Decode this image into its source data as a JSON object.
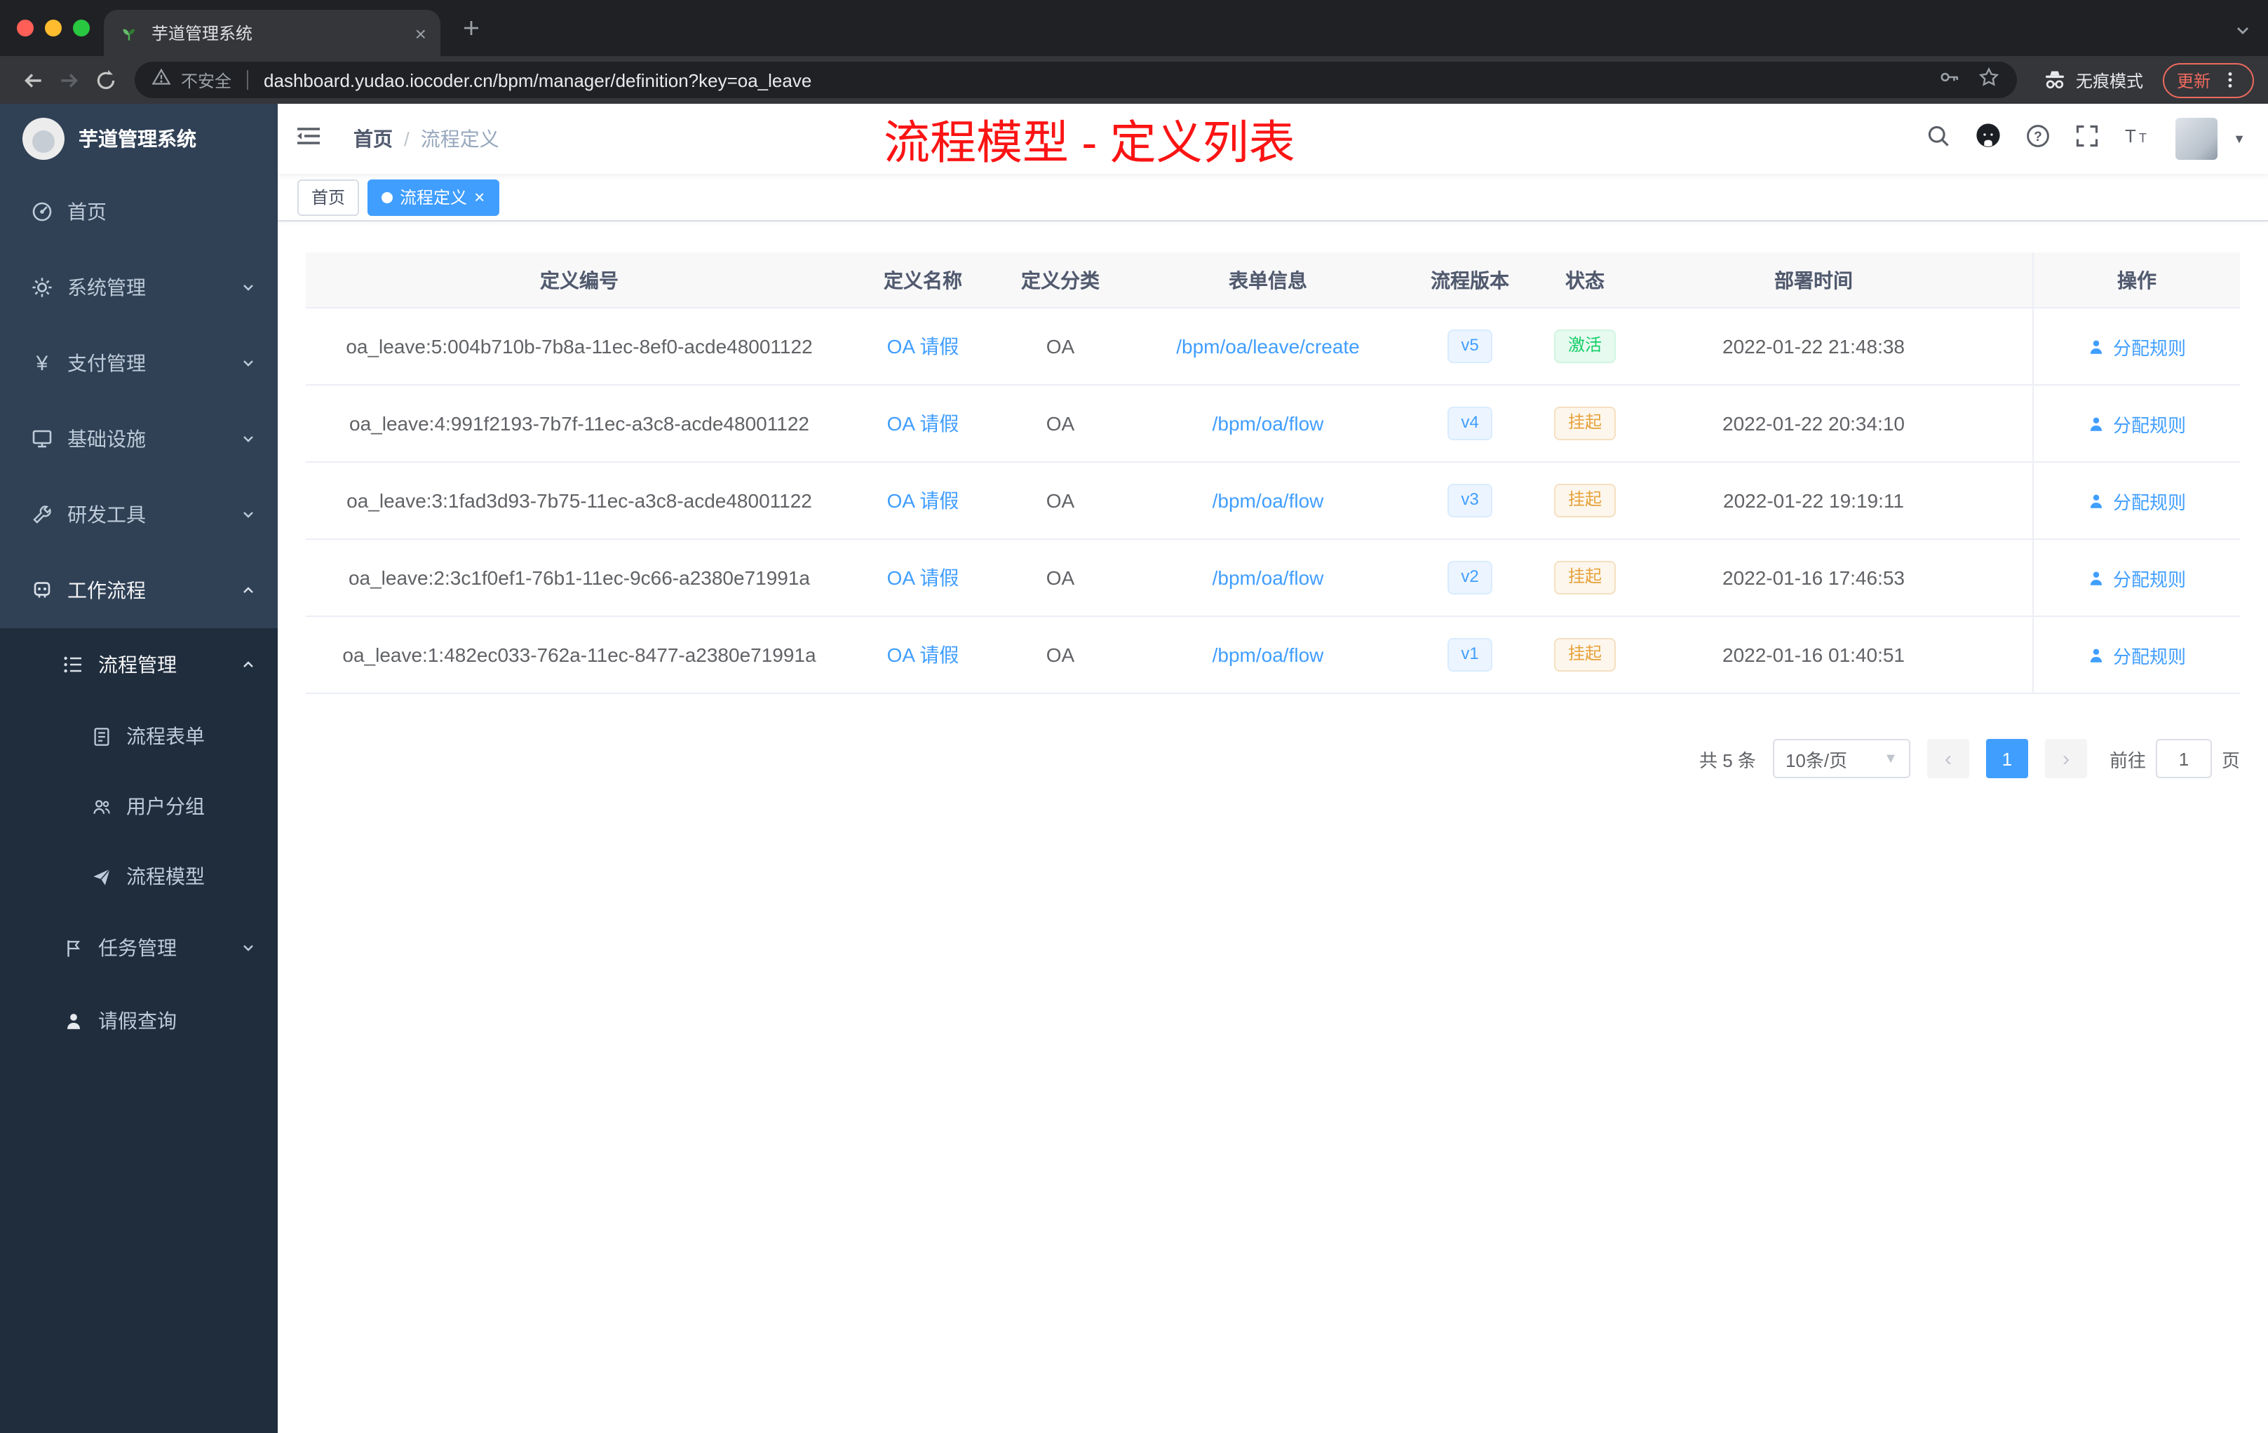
{
  "colors": {
    "accent": "#409eff",
    "success": "#13ce66",
    "warning": "#e6a23c",
    "annotation": "#fb1414",
    "sidebar_bg": "#304156",
    "submenu_bg": "#1f2d3d"
  },
  "browser": {
    "tab_title": "芋道管理系统",
    "security_label": "不安全",
    "url": "dashboard.yudao.iocoder.cn/bpm/manager/definition?key=oa_leave",
    "incognito_label": "无痕模式",
    "update_label": "更新"
  },
  "sidebar": {
    "logo_title": "芋道管理系统",
    "items": [
      {
        "label": "首页"
      },
      {
        "label": "系统管理"
      },
      {
        "label": "支付管理"
      },
      {
        "label": "基础设施"
      },
      {
        "label": "研发工具"
      },
      {
        "label": "工作流程"
      }
    ],
    "submenu": {
      "group_label": "流程管理",
      "group_children": [
        {
          "label": "流程表单"
        },
        {
          "label": "用户分组"
        },
        {
          "label": "流程模型"
        }
      ],
      "task_label": "任务管理",
      "leave_label": "请假查询"
    }
  },
  "navbar": {
    "breadcrumb_home": "首页",
    "breadcrumb_sep": "/",
    "breadcrumb_current": "流程定义",
    "annotation": "流程模型 - 定义列表"
  },
  "tags": {
    "home": "首页",
    "active": "流程定义",
    "close": "×"
  },
  "table": {
    "columns": [
      "定义编号",
      "定义名称",
      "定义分类",
      "表单信息",
      "流程版本",
      "状态",
      "部署时间",
      "操作"
    ],
    "rows": [
      {
        "id": "oa_leave:5:004b710b-7b8a-11ec-8ef0-acde48001122",
        "name": "OA 请假",
        "category": "OA",
        "form": "/bpm/oa/leave/create",
        "version": "v5",
        "status": "激活",
        "status_type": "success",
        "time": "2022-01-22 21:48:38",
        "action": "分配规则"
      },
      {
        "id": "oa_leave:4:991f2193-7b7f-11ec-a3c8-acde48001122",
        "name": "OA 请假",
        "category": "OA",
        "form": "/bpm/oa/flow",
        "version": "v4",
        "status": "挂起",
        "status_type": "warning",
        "time": "2022-01-22 20:34:10",
        "action": "分配规则"
      },
      {
        "id": "oa_leave:3:1fad3d93-7b75-11ec-a3c8-acde48001122",
        "name": "OA 请假",
        "category": "OA",
        "form": "/bpm/oa/flow",
        "version": "v3",
        "status": "挂起",
        "status_type": "warning",
        "time": "2022-01-22 19:19:11",
        "action": "分配规则"
      },
      {
        "id": "oa_leave:2:3c1f0ef1-76b1-11ec-9c66-a2380e71991a",
        "name": "OA 请假",
        "category": "OA",
        "form": "/bpm/oa/flow",
        "version": "v2",
        "status": "挂起",
        "status_type": "warning",
        "time": "2022-01-16 17:46:53",
        "action": "分配规则"
      },
      {
        "id": "oa_leave:1:482ec033-762a-11ec-8477-a2380e71991a",
        "name": "OA 请假",
        "category": "OA",
        "form": "/bpm/oa/flow",
        "version": "v1",
        "status": "挂起",
        "status_type": "warning",
        "time": "2022-01-16 01:40:51",
        "action": "分配规则"
      }
    ]
  },
  "pagination": {
    "total": "共 5 条",
    "page_size": "10条/页",
    "current_page": "1",
    "goto_label": "前往",
    "goto_value": "1",
    "page_unit": "页"
  }
}
